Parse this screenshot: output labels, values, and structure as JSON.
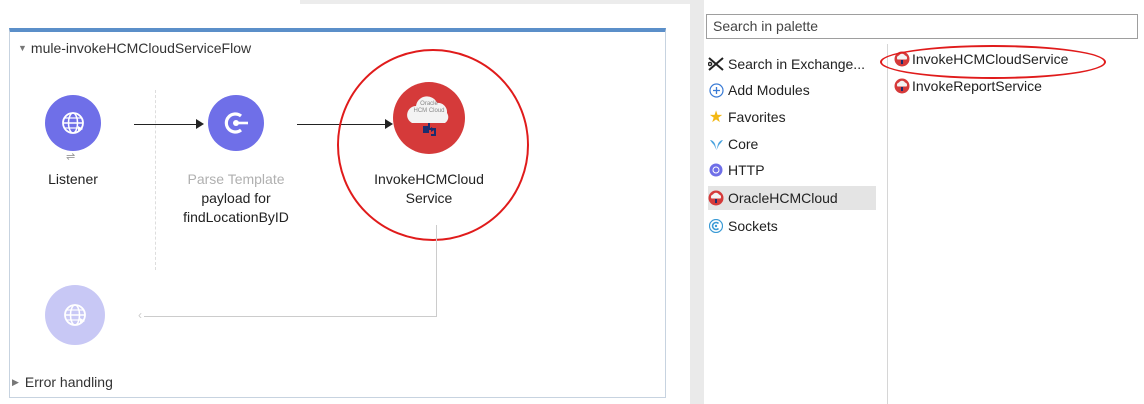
{
  "flow": {
    "name": "mule-invokeHCMCloudServiceFlow",
    "nodes": [
      {
        "label": "Listener",
        "icon": "globe-icon"
      },
      {
        "label_gray": "Parse Template",
        "label": "payload for findLocationByID",
        "icon": "template-icon"
      },
      {
        "label": "InvokeHCMCloud Service",
        "icon_text_1": "Oracle",
        "icon_text_2": "HCM Cloud",
        "icon": "oracle-hcm-cloud-icon"
      }
    ],
    "error_handling": "Error handling"
  },
  "palette": {
    "search_placeholder": "Search in palette",
    "modules": [
      {
        "label": "Search in Exchange...",
        "icon": "exchange-icon"
      },
      {
        "label": "Add Modules",
        "icon": "plus-circle-icon"
      },
      {
        "label": "Favorites",
        "icon": "star-icon"
      },
      {
        "label": "Core",
        "icon": "mule-icon"
      },
      {
        "label": "HTTP",
        "icon": "http-icon"
      },
      {
        "label": "OracleHCMCloud",
        "icon": "oracle-icon",
        "selected": true
      },
      {
        "label": "Sockets",
        "icon": "sockets-icon"
      }
    ],
    "operations": [
      {
        "label": "InvokeHCMCloudService",
        "icon": "oracle-icon"
      },
      {
        "label": "InvokeReportService",
        "icon": "oracle-icon"
      }
    ]
  },
  "colors": {
    "node_purple": "#6f6fe8",
    "oracle_red": "#d53a3a",
    "highlight_ring": "#e01b1b",
    "flow_border": "#5b8fc9"
  }
}
